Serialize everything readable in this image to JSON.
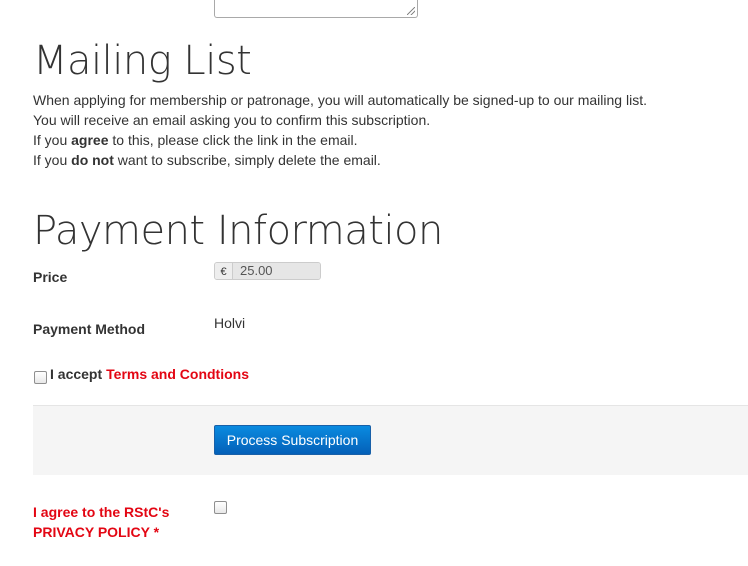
{
  "mailing_list": {
    "title": "Mailing List",
    "line1": "When applying for membership or patronage, you will automatically be signed-up to our mailing list.",
    "line2": "You will receive an email asking you to confirm this subscription.",
    "line3_pre": "If you ",
    "line3_bold": "agree",
    "line3_post": " to this, please click the link in the email.",
    "line4_pre": "If you ",
    "line4_bold": "do not",
    "line4_post": " want to subscribe, simply delete the email."
  },
  "payment": {
    "title": "Payment Information",
    "price_label": "Price",
    "currency_symbol": "€",
    "price_value": "25.00",
    "method_label": "Payment Method",
    "method_value": "Holvi",
    "accept_label": "I accept",
    "terms_link": "Terms and Condtions",
    "terms_checked": false,
    "submit_label": "Process Subscription"
  },
  "privacy": {
    "label_line1": "I agree to the RStC's",
    "label_line2": "PRIVACY POLICY *",
    "checked": false
  },
  "colors": {
    "accent_red": "#e30613",
    "button_blue": "#0a75cf"
  }
}
